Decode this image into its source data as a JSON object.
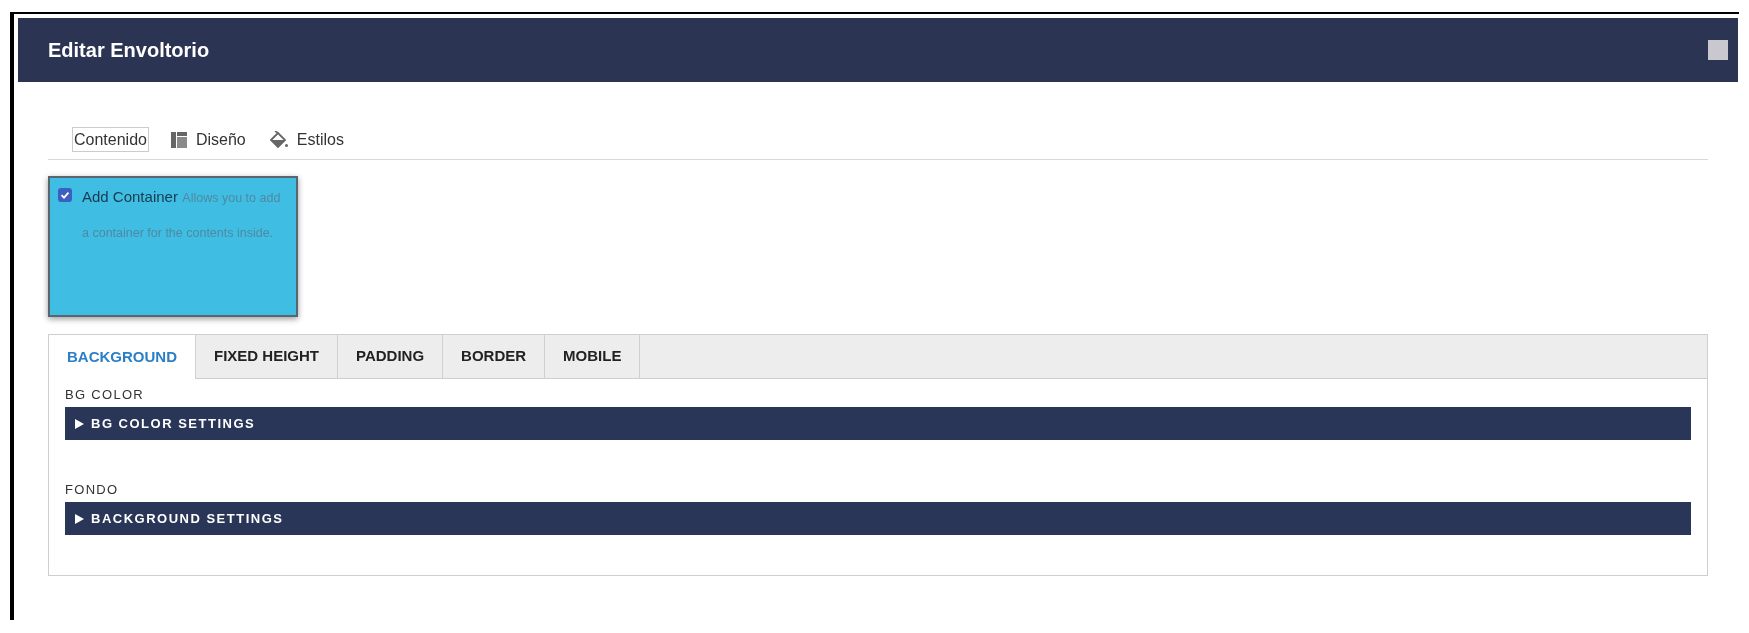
{
  "window": {
    "title": "Editar Envoltorio"
  },
  "tabs": [
    {
      "label": "Contenido",
      "selected": true
    },
    {
      "label": "Diseño",
      "selected": false
    },
    {
      "label": "Estilos",
      "selected": false
    }
  ],
  "option": {
    "label": "Add Container",
    "description": "Allows you to add a container for the contents inside.",
    "checked": true
  },
  "settings_tabs": [
    {
      "label": "BACKGROUND",
      "selected": true
    },
    {
      "label": "FIXED HEIGHT",
      "selected": false
    },
    {
      "label": "PADDING",
      "selected": false
    },
    {
      "label": "BORDER",
      "selected": false
    },
    {
      "label": "MOBILE",
      "selected": false
    }
  ],
  "sections": [
    {
      "label": "BG COLOR",
      "panel": {
        "title": "BG COLOR SETTINGS",
        "expanded": false
      }
    },
    {
      "label": "FONDO",
      "panel": {
        "title": "BACKGROUND SETTINGS",
        "expanded": false
      }
    }
  ]
}
